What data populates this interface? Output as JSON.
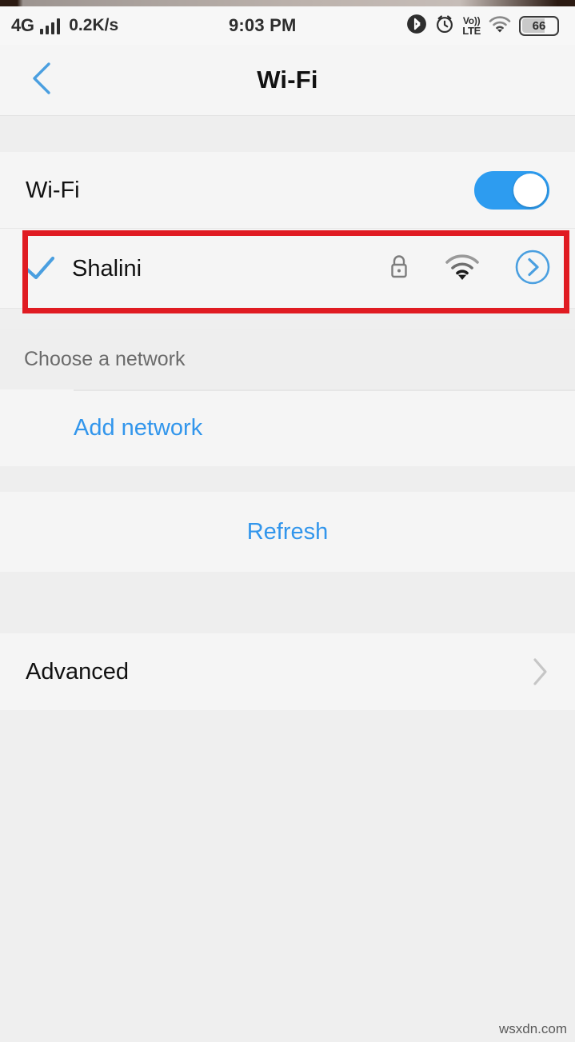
{
  "status_bar": {
    "network_type": "4G",
    "signal_icon": "signal-bars-icon",
    "data_speed": "0.2K/s",
    "time": "9:03 PM",
    "icons": [
      "bluetooth-icon",
      "alarm-clock-icon",
      "volte-icon",
      "wifi-icon",
      "battery-icon"
    ],
    "volte_top": "Vo))",
    "volte_bottom": "LTE",
    "battery_percent": "66"
  },
  "header": {
    "back_icon": "chevron-left-icon",
    "title": "Wi-Fi"
  },
  "wifi_toggle_row": {
    "label": "Wi-Fi",
    "toggle_state": "on",
    "toggle_color": "#2d9cf0"
  },
  "connected_network": {
    "check_icon": "checkmark-icon",
    "name": "Shalini",
    "lock_icon": "lock-icon",
    "signal_icon": "wifi-signal-icon",
    "detail_icon": "chevron-right-circle-icon",
    "highlight_color": "#e01b22"
  },
  "network_section": {
    "header": "Choose a network",
    "add_network_label": "Add network"
  },
  "refresh": {
    "label": "Refresh"
  },
  "advanced": {
    "label": "Advanced",
    "chevron_icon": "chevron-right-icon"
  },
  "watermark": "wsxdn.com",
  "colors": {
    "accent_blue": "#3296ec",
    "card_bg": "#f5f5f5",
    "page_bg": "#efefef",
    "section_bg": "#eeeeee"
  }
}
